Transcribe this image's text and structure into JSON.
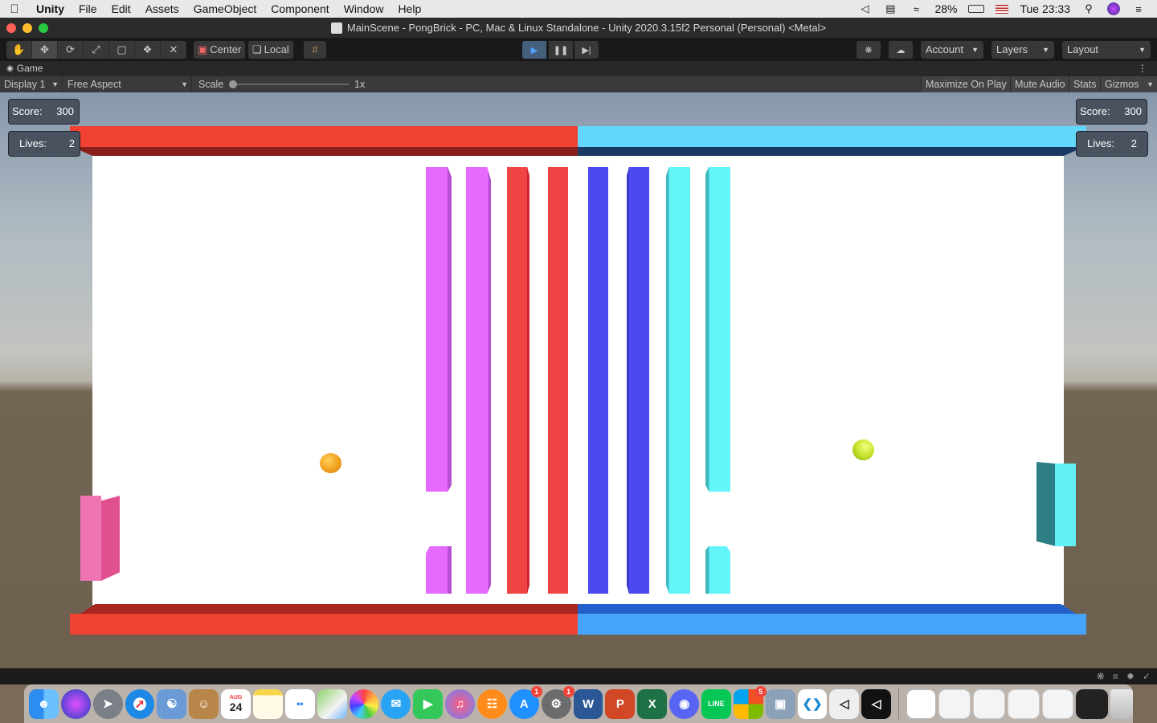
{
  "menubar": {
    "app_name": "Unity",
    "items": [
      "File",
      "Edit",
      "Assets",
      "GameObject",
      "Component",
      "Window",
      "Help"
    ],
    "battery": "28%",
    "clock": "Tue 23:33"
  },
  "window": {
    "title": "MainScene - PongBrick - PC, Mac & Linux Standalone - Unity 2020.3.15f2 Personal (Personal) <Metal>"
  },
  "toolbar": {
    "pivot_center": "Center",
    "pivot_local": "Local",
    "account": "Account",
    "layers": "Layers",
    "layout": "Layout"
  },
  "game_tab": {
    "label": "Game",
    "display": "Display 1",
    "aspect": "Free Aspect",
    "scale_label": "Scale",
    "scale_value": "1x",
    "maximize": "Maximize On Play",
    "mute": "Mute Audio",
    "stats": "Stats",
    "gizmos": "Gizmos"
  },
  "hud": {
    "left_score_label": "Score:",
    "left_score": "300",
    "left_lives_label": "Lives:",
    "left_lives": "2",
    "right_score_label": "Score:",
    "right_score": "300",
    "right_lives_label": "Lives:",
    "right_lives": "2"
  },
  "colors": {
    "red_team": "#ef4232",
    "blue_team": "#45a4f9",
    "magenta_brick": "#e76aff",
    "red_brick": "#ee4444",
    "blue_brick": "#4a4af0",
    "cyan_brick": "#63f5f8",
    "pink_paddle": "#ef74b2",
    "cyan_paddle": "#63f0f5",
    "orange_ball": "#f2a01e",
    "green_ball": "#c6e32a"
  },
  "dock": {
    "calendar_day": "24",
    "calendar_month": "AUG",
    "badges": {
      "app_store": "1",
      "system_prefs": "1",
      "microsoft": "5"
    }
  }
}
